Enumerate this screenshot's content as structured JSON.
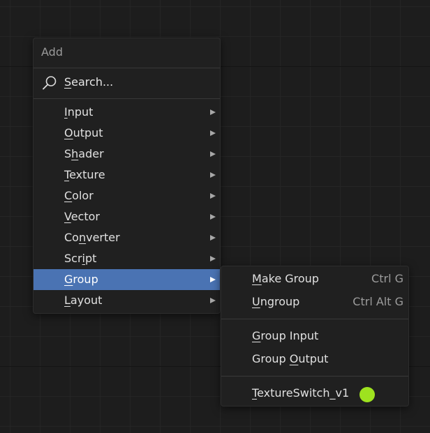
{
  "menu": {
    "title": "Add",
    "search": {
      "icon": "search-icon",
      "before": "",
      "key": "S",
      "after": "earch..."
    },
    "items": [
      {
        "id": "input",
        "before": "",
        "key": "I",
        "after": "nput",
        "submenu": true
      },
      {
        "id": "output",
        "before": "",
        "key": "O",
        "after": "utput",
        "submenu": true
      },
      {
        "id": "shader",
        "before": "S",
        "key": "h",
        "after": "ader",
        "submenu": true
      },
      {
        "id": "texture",
        "before": "",
        "key": "T",
        "after": "exture",
        "submenu": true
      },
      {
        "id": "color",
        "before": "",
        "key": "C",
        "after": "olor",
        "submenu": true
      },
      {
        "id": "vector",
        "before": "",
        "key": "V",
        "after": "ector",
        "submenu": true
      },
      {
        "id": "converter",
        "before": "Co",
        "key": "n",
        "after": "verter",
        "submenu": true
      },
      {
        "id": "script",
        "before": "Scr",
        "key": "i",
        "after": "pt",
        "submenu": true
      },
      {
        "id": "group",
        "before": "",
        "key": "G",
        "after": "roup",
        "submenu": true,
        "active": true
      },
      {
        "id": "layout",
        "before": "",
        "key": "L",
        "after": "ayout",
        "submenu": true
      }
    ]
  },
  "submenu": {
    "items": [
      {
        "id": "make-group",
        "before": "",
        "key": "M",
        "after": "ake Group",
        "shortcut": "Ctrl G"
      },
      {
        "id": "ungroup",
        "before": "",
        "key": "U",
        "after": "ngroup",
        "shortcut": "Ctrl Alt G"
      },
      {
        "id": "group-input",
        "before": "",
        "key": "G",
        "after": "roup Input",
        "shortcut": ""
      },
      {
        "id": "group-output",
        "before": "Group ",
        "key": "O",
        "after": "utput",
        "shortcut": ""
      },
      {
        "id": "textureswitch",
        "before": "",
        "key": "T",
        "after": "extureSwitch_v1",
        "shortcut": ""
      }
    ],
    "node_group_color": "#9ee21f"
  },
  "colors": {
    "background": "#1d1d1d",
    "menu_bg": "#202020",
    "highlight": "#4a73b3"
  }
}
